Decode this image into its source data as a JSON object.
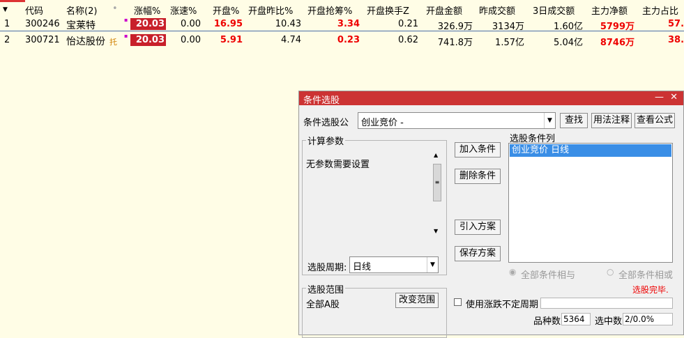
{
  "table": {
    "headers": [
      "代码",
      "名称(2)",
      "•",
      "涨幅%",
      "涨速%",
      "开盘%",
      "开盘昨比%",
      "开盘抢筹%",
      "开盘换手Z",
      "开盘金额",
      "昨成交额",
      "3日成交额",
      "主力净额",
      "主力占比"
    ],
    "rows": [
      {
        "idx": "1",
        "code": "300246",
        "name": "宝莱特",
        "mark": "▪",
        "flag": "",
        "chg": "20.03",
        "speed": "0.00",
        "open": "16.95",
        "open_ratio": "10.43",
        "grab": "3.34",
        "turnover": "0.21",
        "amount": "326.9万",
        "y_vol": "3134万",
        "vol3": "1.60亿",
        "net": "5799万",
        "pct": "57."
      },
      {
        "idx": "2",
        "code": "300721",
        "name": "怡达股份",
        "mark": "▪",
        "flag": "托",
        "chg": "20.03",
        "speed": "0.00",
        "open": "5.91",
        "open_ratio": "4.74",
        "grab": "0.23",
        "turnover": "0.62",
        "amount": "741.8万",
        "y_vol": "1.57亿",
        "vol3": "5.04亿",
        "net": "8746万",
        "pct": "38."
      }
    ]
  },
  "dialog": {
    "title": "条件选股",
    "min_glyph": "—",
    "close_glyph": "✕",
    "formula_label": "条件选股公",
    "formula_value": "创业竞价  -",
    "btn_find": "查找",
    "btn_usage": "用法注释",
    "btn_view": "查看公式",
    "params_title": "计算参数",
    "params_text": "无参数需要设置",
    "list_title": "选股条件列",
    "list_item": "创业竞价  日线",
    "btn_add": "加入条件",
    "btn_delete": "删除条件",
    "btn_import": "引入方案",
    "btn_save": "保存方案",
    "period_label": "选股周期:",
    "period_value": "日线",
    "radio_and": "全部条件相与",
    "radio_or": "全部条件相或",
    "status": "选股完毕.",
    "scope_title": "选股范围",
    "scope_value": "全部A股",
    "btn_scope": "改变范围",
    "use_period": "使用涨跌不定周期",
    "count_label": "品种数",
    "count_value": "5364",
    "selected_label": "选中数",
    "selected_value": "2/0.0%"
  },
  "colors": {
    "badge": "#c8202a",
    "red": "#e00000",
    "title": "#cc3333",
    "bg": "#fffde6"
  }
}
